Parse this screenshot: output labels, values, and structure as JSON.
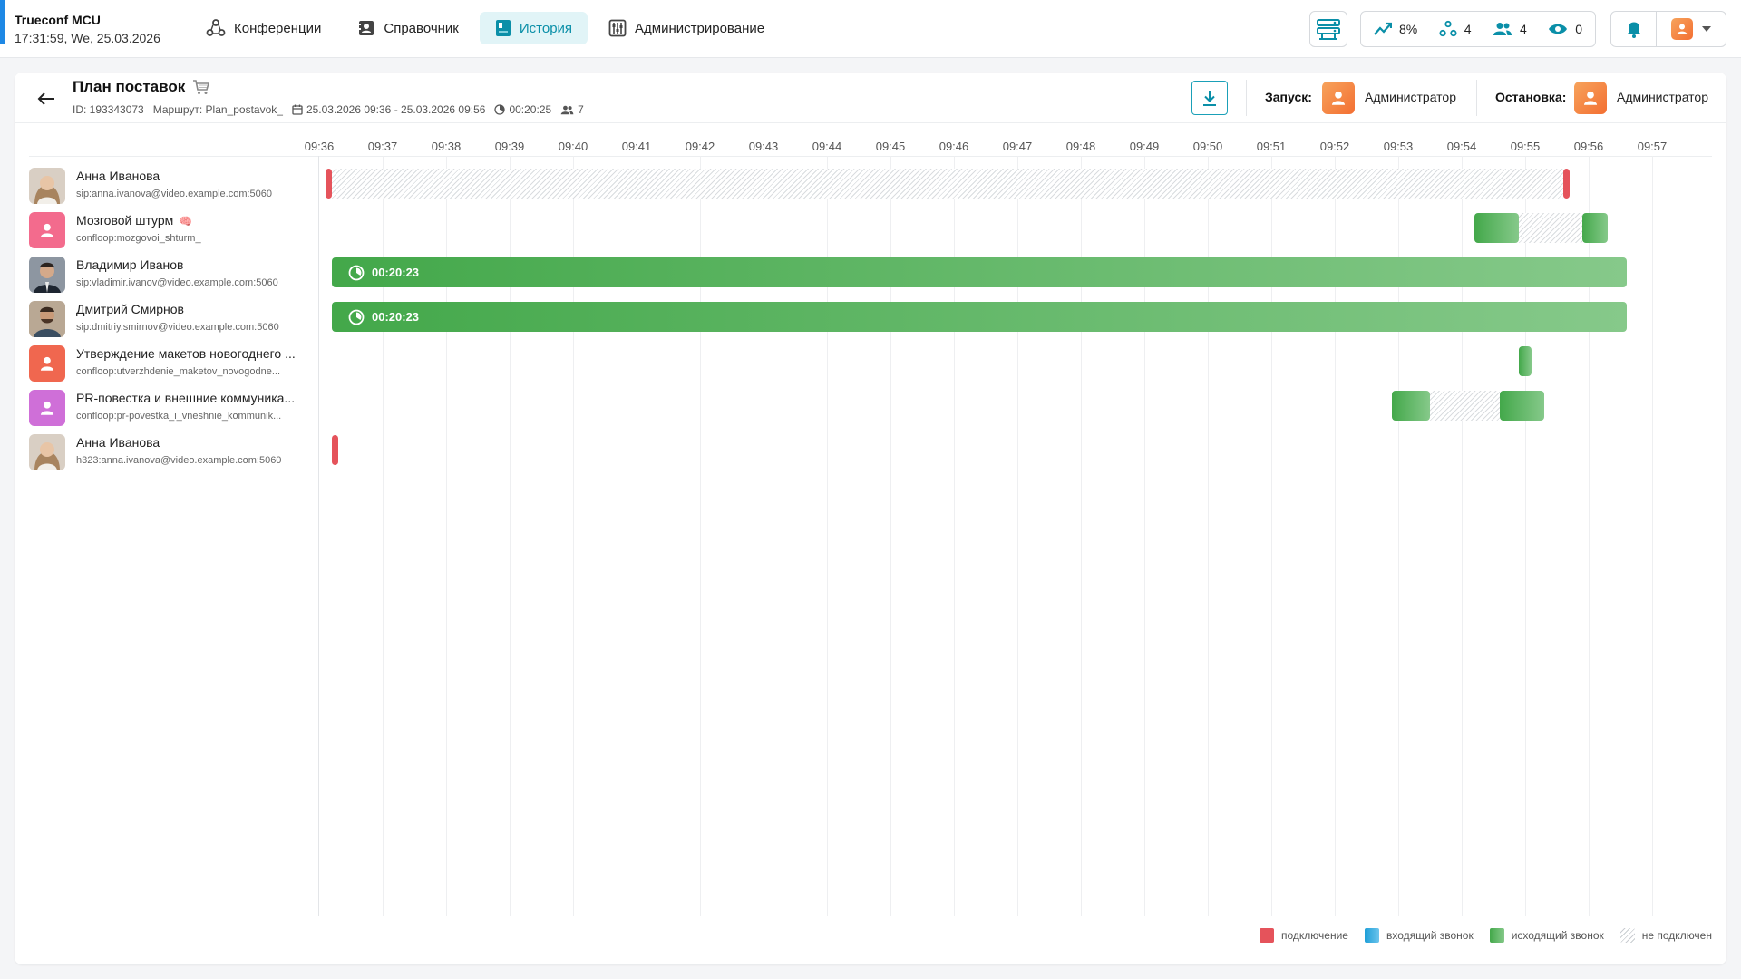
{
  "app": {
    "name": "Trueconf MCU",
    "datetime": "17:31:59, We, 25.03.2026"
  },
  "nav": [
    {
      "label": "Конференции",
      "icon": "conferences-icon",
      "active": false
    },
    {
      "label": "Справочник",
      "icon": "address-book-icon",
      "active": false
    },
    {
      "label": "История",
      "icon": "history-icon",
      "active": true
    },
    {
      "label": "Администрирование",
      "icon": "admin-icon",
      "active": false
    }
  ],
  "stats": {
    "load": "8%",
    "conferences": "4",
    "participants": "4",
    "viewers": "0"
  },
  "conference": {
    "title": "План поставок",
    "id_text": "ID: 193343073",
    "route_text": "Маршрут: Plan_postavok_",
    "period": "25.03.2026 09:36 - 25.03.2026 09:56",
    "duration": "00:20:25",
    "participants_count": "7",
    "start_label": "Запуск:",
    "start_by": "Администратор",
    "stop_label": "Остановка:",
    "stop_by": "Администратор"
  },
  "timeline": {
    "ticks": [
      "09:36",
      "09:37",
      "09:38",
      "09:39",
      "09:40",
      "09:41",
      "09:42",
      "09:43",
      "09:44",
      "09:45",
      "09:46",
      "09:47",
      "09:48",
      "09:49",
      "09:50",
      "09:51",
      "09:52",
      "09:53",
      "09:54",
      "09:55",
      "09:56",
      "09:57"
    ],
    "rows": [
      {
        "name": "Анна Иванова",
        "address": "sip:anna.ivanova@video.example.com:5060",
        "avatar": "photo-woman",
        "segments": [
          {
            "type": "connect",
            "start": 0.1,
            "end": 0.2
          },
          {
            "type": "none",
            "start": 0.2,
            "end": 19.6
          },
          {
            "type": "connect",
            "start": 19.6,
            "end": 19.7
          }
        ]
      },
      {
        "name": "Мозговой штурм",
        "emoji": "🧠",
        "address": "confloop:mozgovoi_shturm_",
        "avatar": "placeholder",
        "avatar_color": "#f36b8d",
        "segments": [
          {
            "type": "out",
            "start": 18.2,
            "end": 18.9
          },
          {
            "type": "none",
            "start": 18.9,
            "end": 19.9
          },
          {
            "type": "out",
            "start": 19.9,
            "end": 20.3
          }
        ]
      },
      {
        "name": "Владимир Иванов",
        "address": "sip:vladimir.ivanov@video.example.com:5060",
        "avatar": "photo-man-1",
        "segments": [
          {
            "type": "out",
            "start": 0.2,
            "end": 20.6,
            "label": "00:20:23"
          }
        ]
      },
      {
        "name": "Дмитрий Смирнов",
        "address": "sip:dmitriy.smirnov@video.example.com:5060",
        "avatar": "photo-man-2",
        "segments": [
          {
            "type": "out",
            "start": 0.2,
            "end": 20.6,
            "label": "00:20:23"
          }
        ]
      },
      {
        "name": "Утверждение макетов новогоднего ...",
        "address": "confloop:utverzhdenie_maketov_novogodne...",
        "avatar": "placeholder",
        "avatar_color": "#f0674f",
        "segments": [
          {
            "type": "out",
            "start": 18.9,
            "end": 19.1
          }
        ]
      },
      {
        "name": "PR-повестка и внешние коммуника...",
        "address": "confloop:pr-povestka_i_vneshnie_kommunik...",
        "avatar": "placeholder",
        "avatar_color": "#cf6fd8",
        "segments": [
          {
            "type": "out",
            "start": 16.9,
            "end": 17.5
          },
          {
            "type": "none",
            "start": 17.5,
            "end": 18.6
          },
          {
            "type": "out",
            "start": 18.6,
            "end": 19.3
          }
        ]
      },
      {
        "name": "Анна Иванова",
        "address": "h323:anna.ivanova@video.example.com:5060",
        "avatar": "photo-woman",
        "segments": [
          {
            "type": "connect",
            "start": 0.2,
            "end": 0.3
          }
        ]
      }
    ]
  },
  "legend": [
    {
      "label": "подключение",
      "type": "connect",
      "color": "#e5535b"
    },
    {
      "label": "входящий звонок",
      "type": "in",
      "color": "#1e9fd8"
    },
    {
      "label": "исходящий звонок",
      "type": "out",
      "color": "#4caf50"
    },
    {
      "label": "не подключен",
      "type": "none",
      "color": "#d9dcdf"
    }
  ],
  "colors": {
    "accent": "#0a8fa8",
    "brand": "#1e88e5",
    "connect": "#e5535b",
    "outgoing": "#4caf50",
    "incoming": "#1e9fd8"
  }
}
